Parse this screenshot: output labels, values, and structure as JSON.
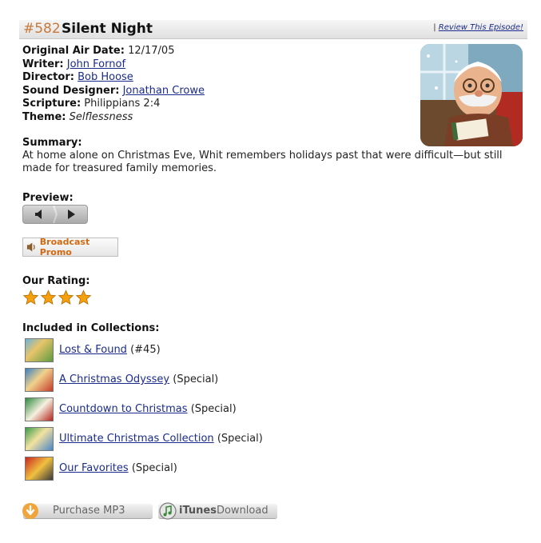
{
  "episode": {
    "number": "#582",
    "title": "Silent Night",
    "review_link": "Review This Episode!",
    "review_prefix": "|"
  },
  "meta": {
    "air_date_label": "Original Air Date:",
    "air_date": "12/17/05",
    "writer_label": "Writer:",
    "writer": "John Fornof",
    "director_label": "Director:",
    "director": "Bob Hoose",
    "sound_label": "Sound Designer:",
    "sound": "Jonathan Crowe",
    "scripture_label": "Scripture:",
    "scripture": "Philippians 2:4",
    "theme_label": "Theme:",
    "theme": "Selflessness"
  },
  "summary": {
    "label": "Summary:",
    "text": "At home alone on Christmas Eve, Whit remembers holidays past that were difficult—but still made for treasured family memories."
  },
  "preview": {
    "label": "Preview:"
  },
  "promo": {
    "label": "Broadcast Promo"
  },
  "rating": {
    "label": "Our Rating:",
    "stars": 4,
    "star_color": "#f5a00f"
  },
  "collections": {
    "label": "Included in Collections:",
    "items": [
      {
        "name": "Lost & Found",
        "note": "(#45)"
      },
      {
        "name": "A Christmas Odyssey",
        "note": "(Special)"
      },
      {
        "name": "Countdown to Christmas",
        "note": "(Special)"
      },
      {
        "name": "Ultimate Christmas Collection",
        "note": "(Special)"
      },
      {
        "name": "Our Favorites",
        "note": "(Special)"
      }
    ]
  },
  "buttons": {
    "purchase": "Purchase MP3",
    "itunes_brand": "iTunes",
    "itunes_action": "Download"
  },
  "colors": {
    "episode_number": "#c8793a",
    "link": "#1a2b8c",
    "promo_text": "#d36a12",
    "purchase_icon": "#f0a43c"
  }
}
